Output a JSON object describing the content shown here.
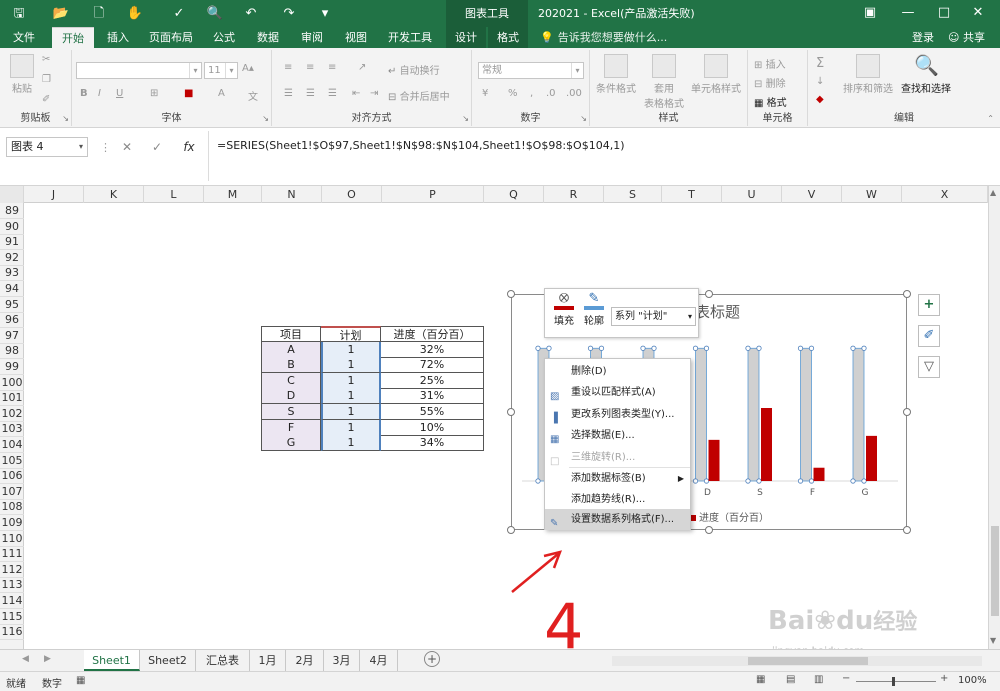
{
  "titlebar": {
    "ctx_tool_label": "图表工具",
    "window_title": "202021 - Excel(产品激活失败)"
  },
  "tabs": {
    "file": "文件",
    "home": "开始",
    "insert": "插入",
    "page_layout": "页面布局",
    "formulas": "公式",
    "data": "数据",
    "review": "审阅",
    "view": "视图",
    "developer": "开发工具",
    "design": "设计",
    "format": "格式",
    "tell_me": "告诉我您想要做什么...",
    "login": "登录",
    "share": "共享"
  },
  "ribbon": {
    "paste": "粘贴",
    "clipboard_label": "剪贴板",
    "font_label": "字体",
    "font_size": "11",
    "bold": "B",
    "italic": "I",
    "underline": "U",
    "wrap_text": "自动换行",
    "merge_center": "合并后居中",
    "alignment_label": "对齐方式",
    "number_format": "常规",
    "percent": "%",
    "comma": ",",
    "number_label": "数字",
    "cond_format": "条件格式",
    "table_format_1": "套用",
    "table_format_2": "表格格式",
    "cell_style": "单元格样式",
    "styles_label": "样式",
    "insert_cells": "插入",
    "delete_cells": "删除",
    "format_cells": "格式",
    "cells_label": "单元格",
    "sort_filter": "排序和筛选",
    "find_select": "查找和选择",
    "editing_label": "编辑"
  },
  "formulabar": {
    "name_box": "图表 4",
    "fx": "fx",
    "formula": "=SERIES(Sheet1!$O$97,Sheet1!$N$98:$N$104,Sheet1!$O$98:$O$104,1)"
  },
  "columns": [
    "J",
    "K",
    "L",
    "M",
    "N",
    "O",
    "P",
    "Q",
    "R",
    "S",
    "T",
    "U",
    "V",
    "W",
    "X"
  ],
  "rows": [
    "89",
    "90",
    "91",
    "92",
    "93",
    "94",
    "95",
    "96",
    "97",
    "98",
    "99",
    "100",
    "101",
    "102",
    "103",
    "104",
    "105",
    "106",
    "107",
    "108",
    "109",
    "110",
    "111",
    "112",
    "113",
    "114",
    "115",
    "116"
  ],
  "table": {
    "headers": [
      "项目",
      "计划",
      "进度（百分百）"
    ],
    "rows": [
      [
        "A",
        "1",
        "32%"
      ],
      [
        "B",
        "1",
        "72%"
      ],
      [
        "C",
        "1",
        "25%"
      ],
      [
        "D",
        "1",
        "31%"
      ],
      [
        "S",
        "1",
        "55%"
      ],
      [
        "F",
        "1",
        "10%"
      ],
      [
        "G",
        "1",
        "34%"
      ]
    ]
  },
  "chart_data": {
    "type": "bar",
    "title": "表标题",
    "categories": [
      "A",
      "B",
      "C",
      "D",
      "S",
      "F",
      "G"
    ],
    "series": [
      {
        "name": "计划",
        "values": [
          1,
          1,
          1,
          1,
          1,
          1,
          1
        ],
        "color": "#d0d0d0"
      },
      {
        "name": "进度（百分百）",
        "values": [
          0.32,
          0.72,
          0.25,
          0.31,
          0.55,
          0.1,
          0.34
        ],
        "color": "#c00000"
      }
    ],
    "ylim": [
      0,
      1.1
    ],
    "visible_categories": [
      "D",
      "S",
      "F",
      "G"
    ],
    "legend_visible": "进度（百分百）"
  },
  "minitoolbar": {
    "fill": "填充",
    "outline": "轮廓",
    "series_select": "系列 \"计划\""
  },
  "context_menu": {
    "items": [
      {
        "label": "删除(D)",
        "disabled": false,
        "highlighted": false,
        "icon": "none"
      },
      {
        "label": "重设以匹配样式(A)",
        "disabled": false,
        "highlighted": false,
        "icon": "reset-icon"
      },
      {
        "label": "更改系列图表类型(Y)...",
        "disabled": false,
        "highlighted": false,
        "icon": "chart-type-icon"
      },
      {
        "label": "选择数据(E)...",
        "disabled": false,
        "highlighted": false,
        "icon": "select-data-icon"
      },
      {
        "label": "三维旋转(R)...",
        "disabled": true,
        "highlighted": false,
        "icon": "rotate-icon"
      },
      {
        "label": "添加数据标签(B)",
        "disabled": false,
        "highlighted": false,
        "icon": "none",
        "submenu": true
      },
      {
        "label": "添加趋势线(R)...",
        "disabled": false,
        "highlighted": false,
        "icon": "none"
      },
      {
        "label": "设置数据系列格式(F)...",
        "disabled": false,
        "highlighted": true,
        "icon": "format-series-icon"
      }
    ]
  },
  "annotation": {
    "number": "4"
  },
  "sheet_tabs": [
    "Sheet1",
    "Sheet2",
    "汇总表",
    "1月",
    "2月",
    "3月",
    "4月"
  ],
  "status": {
    "ready": "就绪",
    "numlock": "数字",
    "zoom": "100%"
  },
  "watermark": {
    "brand": "Bai",
    "brand2": "du",
    "brand_cn": "经验",
    "url": "jingyan.baidu.com"
  },
  "colors": {
    "excel_green": "#217346",
    "bar_red": "#c00000",
    "bar_gray": "#d0d0d0",
    "annotation_red": "#e02020"
  }
}
